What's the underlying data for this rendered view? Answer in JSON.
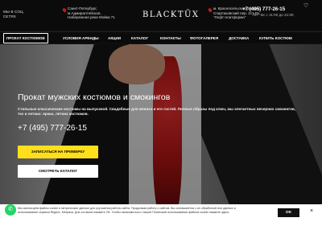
{
  "header": {
    "social_label_line1": "МЫ В СОЦ.",
    "social_label_line2": "СЕТЯХ",
    "address_left_line1": "Санкт-Петербург,",
    "address_left_line2": "м.Адмиралтейская,",
    "address_left_line3": "Набережная реки Мойки 71",
    "logo": "BLACKTÜX",
    "address_right_line1": "м. Красносельская (Бизнес",
    "address_right_line2": "Спартаковский пер. 2с1 Вх.",
    "address_right_line3": "\"Лофт-платформа\"",
    "phone": "+7 (495) 777-26-15",
    "hours_line1": "Пн - Вс с 11:00 до 21:00",
    "hours_line2": "Пн"
  },
  "nav": {
    "items": [
      {
        "label": "ПРОКАТ КОСТЮМОВ"
      },
      {
        "label": "УСЛОВИЯ АРЕНДЫ"
      },
      {
        "label": "АКЦИИ"
      },
      {
        "label": "КАТАЛОГ"
      },
      {
        "label": "КОНТАКТЫ"
      },
      {
        "label": "ФОТОГАЛЕРЕЯ"
      },
      {
        "label": "ДОСТАВКА"
      },
      {
        "label": "КУПИТЬ КОСТЮМ"
      }
    ]
  },
  "hero": {
    "title": "Прокат мужских костюмов и смокингов",
    "desc_line1": "Стильные классические костюмы на выпускной. Свадебные для жениха и его гостей. Полные образы под ключ, мы элегантных вечерних смокингов,",
    "desc_line2": "тех и летних: ярких, летних костюмов.",
    "phone": "+7 (495) 777-26-15",
    "primary_button": "ЗАПИСАТЬСЯ НА ПРИМЕРКУ",
    "secondary_button": "СМОТРЕТЬ КАТАЛОГ"
  },
  "cookie": {
    "text_line1": "Мы используем файлы cookie и метрические данные для улучшения работы сайта. Продолжая работу с сайтом, Вы соглашаетесь с их обработкой или данных и",
    "text_line2": "использование сервиса Яндекс. Метрика. Для согласия нажмите OK. Чтобы ознакомиться с нашей Политикой использования файлов cookie нажмите здесь.",
    "ok_label": "OK",
    "close_glyph": "×"
  },
  "icons": {
    "heart": "heart-icon",
    "whatsapp": "whatsapp-icon",
    "location": "location-pin-icon"
  },
  "colors": {
    "accent_yellow": "#ffdf1a",
    "tie_red": "#b31515",
    "whatsapp_green": "#25d366",
    "header_bg": "#0b0b0b"
  }
}
